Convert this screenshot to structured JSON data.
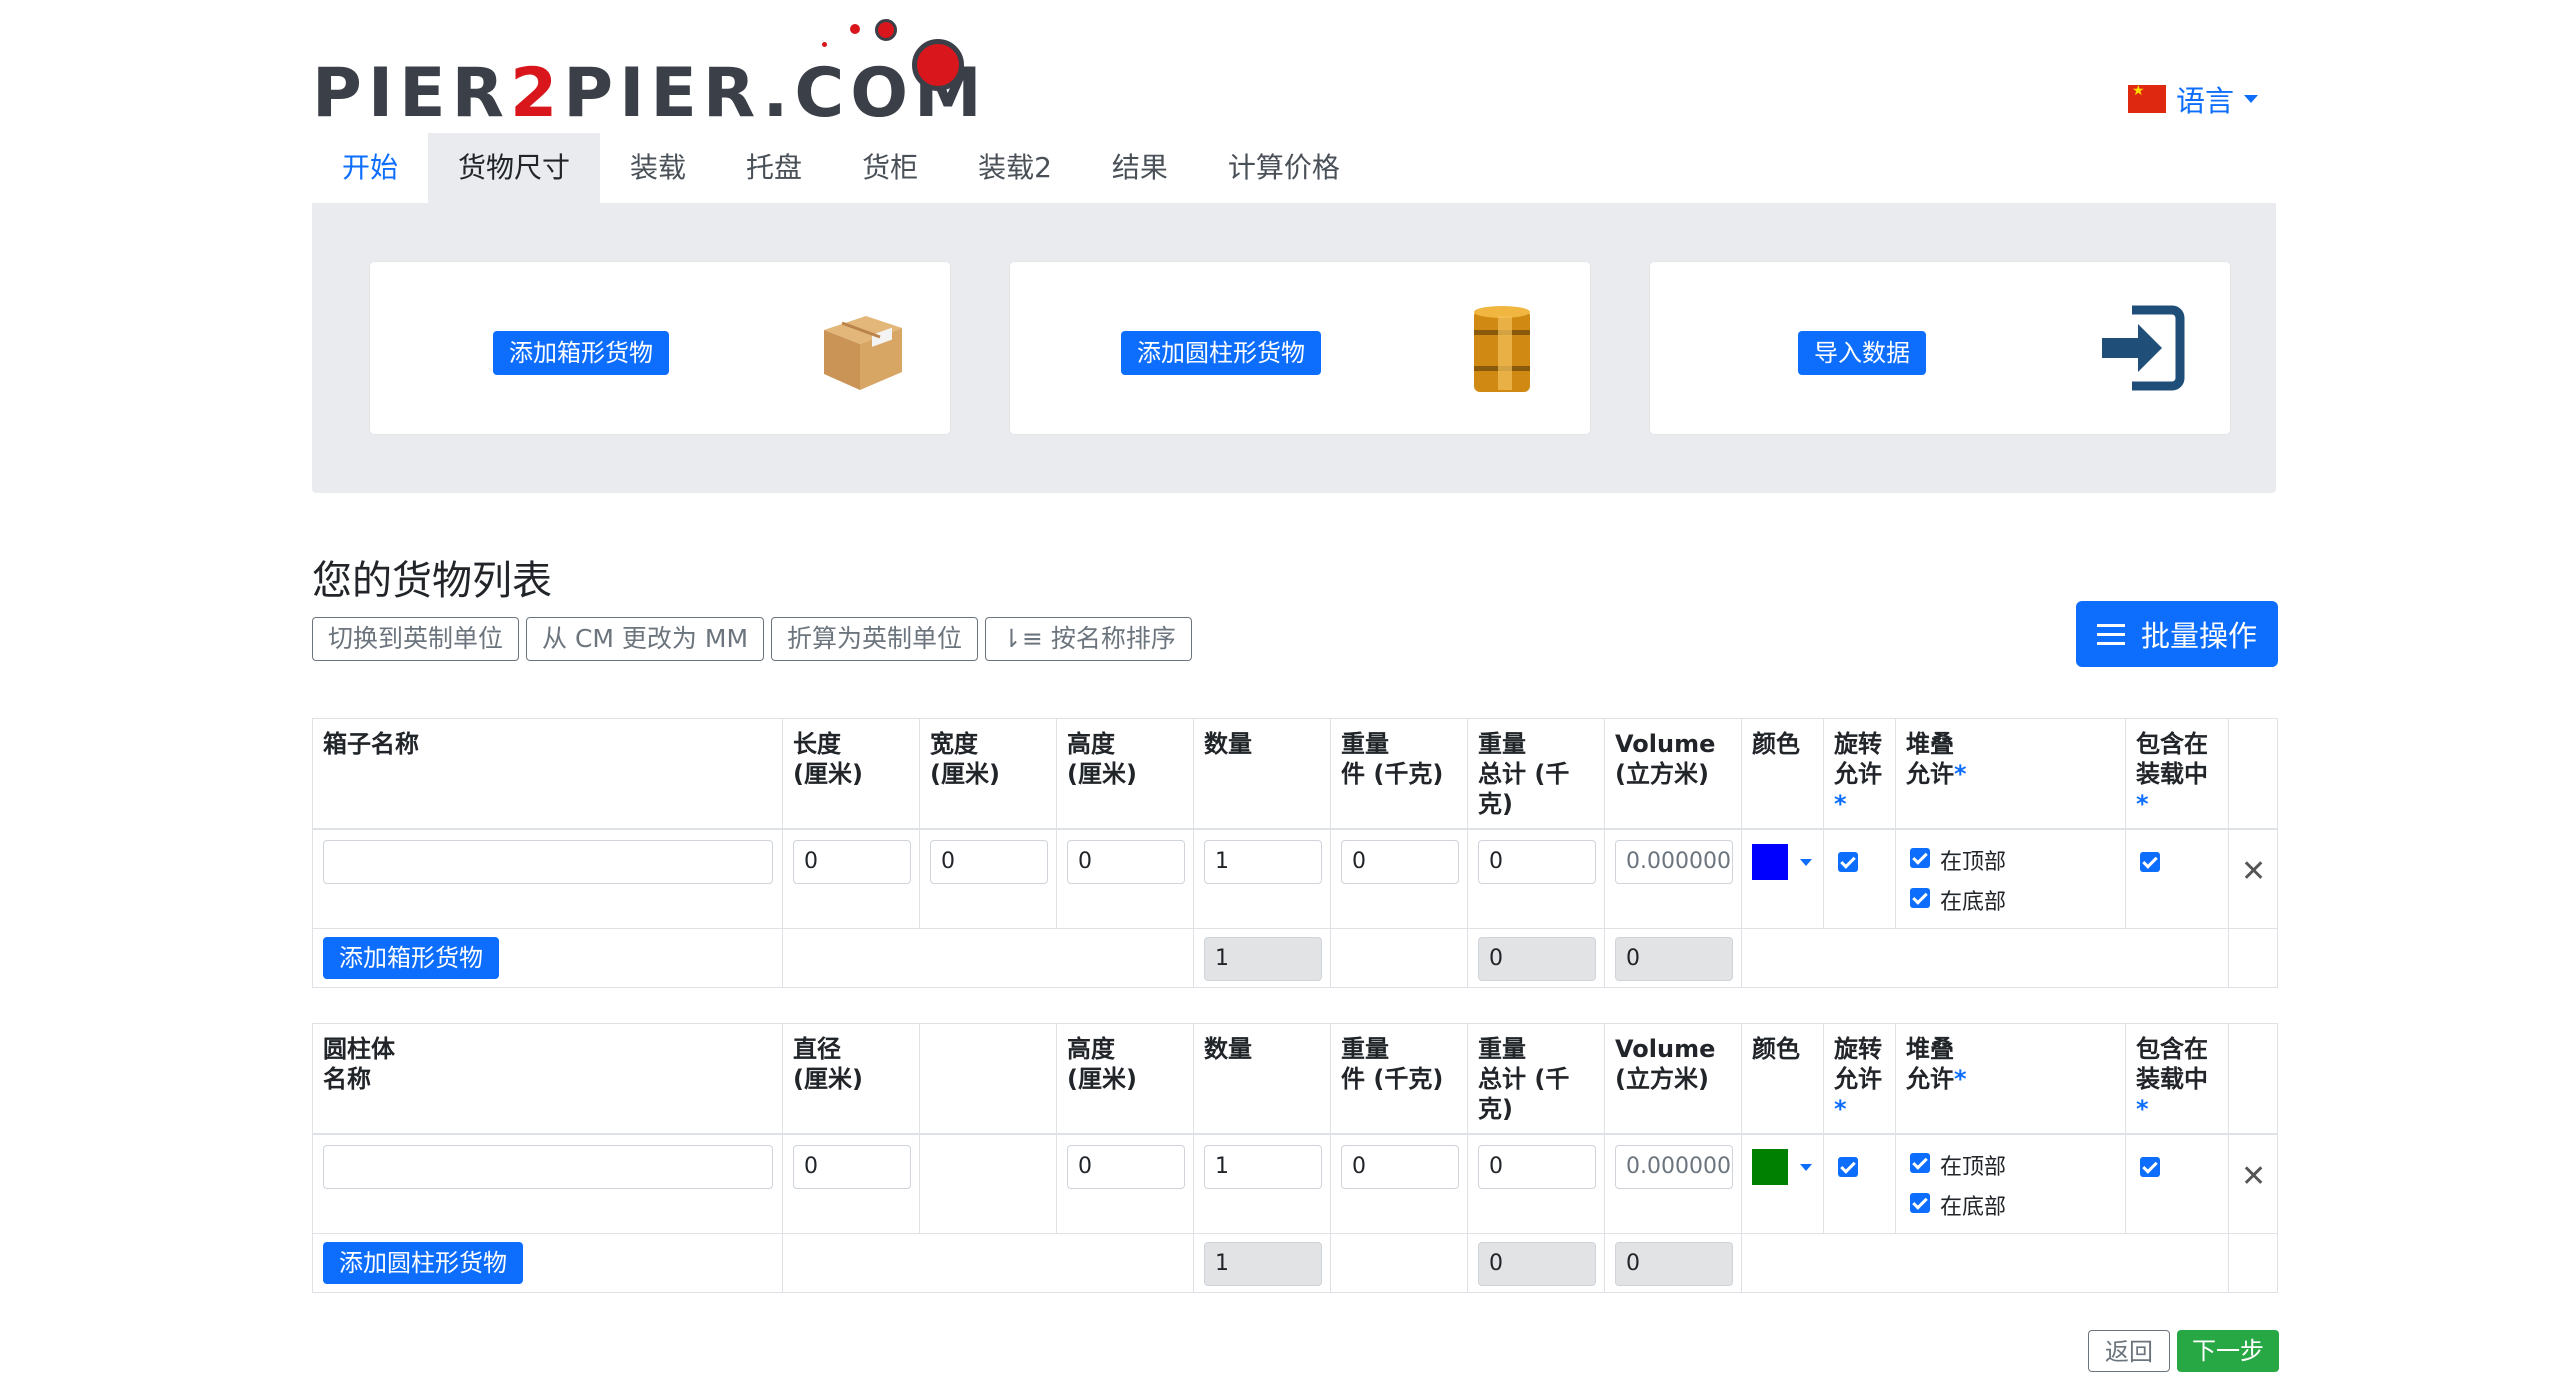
{
  "logo": {
    "part1": "PIER",
    "part2": "2",
    "part3": "PIER.COM"
  },
  "language": {
    "label": "语言"
  },
  "tabs": [
    "开始",
    "货物尺寸",
    "装载",
    "托盘",
    "货柜",
    "装载2",
    "结果",
    "计算价格"
  ],
  "cards": {
    "box": {
      "button": "添加箱形货物",
      "icon": "cardboard-box-icon"
    },
    "cylinder": {
      "button": "添加圆柱形货物",
      "icon": "barrel-icon"
    },
    "import": {
      "button": "导入数据",
      "icon": "import-icon"
    }
  },
  "list": {
    "title": "您的货物列表",
    "tools": [
      "切换到英制单位",
      "从 CM 更改为 MM",
      "折算为英制单位",
      "按名称排序"
    ],
    "bulk": "批量操作"
  },
  "box_table": {
    "headers": {
      "name": "箱子名称",
      "length": [
        "长度",
        "(厘米)"
      ],
      "width": [
        "宽度",
        "(厘米)"
      ],
      "height": [
        "高度",
        "(厘米)"
      ],
      "qty": "数量",
      "weight_piece": [
        "重量",
        "件 (千克)"
      ],
      "weight_total": [
        "重量",
        "总计 (千",
        "克)"
      ],
      "volume": [
        "Volume",
        "(立方米)"
      ],
      "color": "颜色",
      "rotate": [
        "旋转",
        "允许",
        "*"
      ],
      "stack": [
        "堆叠",
        "允许",
        "*"
      ],
      "include": [
        "包含在",
        "装载中",
        "*"
      ]
    },
    "row": {
      "name": "",
      "length": "0",
      "width": "0",
      "height": "0",
      "qty": "1",
      "weight_piece": "0",
      "weight_total": "0",
      "volume": "0.000000",
      "color": "#0000ff",
      "stack_top": "在顶部",
      "stack_bottom": "在底部"
    },
    "footer": {
      "add": "添加箱形货物",
      "qty_total": "1",
      "weight_total": "0",
      "volume_total": "0"
    }
  },
  "cyl_table": {
    "headers": {
      "name": [
        "圆柱体",
        "名称"
      ],
      "diameter": [
        "直径",
        "(厘米)"
      ],
      "height": [
        "高度",
        "(厘米)"
      ],
      "qty": "数量",
      "weight_piece": [
        "重量",
        "件 (千克)"
      ],
      "weight_total": [
        "重量",
        "总计 (千",
        "克)"
      ],
      "volume": [
        "Volume",
        "(立方米)"
      ],
      "color": "颜色",
      "rotate": [
        "旋转",
        "允许",
        "*"
      ],
      "stack": [
        "堆叠",
        "允许",
        "*"
      ],
      "include": [
        "包含在",
        "装载中",
        "*"
      ]
    },
    "row": {
      "name": "",
      "diameter": "0",
      "height": "0",
      "qty": "1",
      "weight_piece": "0",
      "weight_total": "0",
      "volume": "0.000000",
      "color": "#008000",
      "stack_top": "在顶部",
      "stack_bottom": "在底部"
    },
    "footer": {
      "add": "添加圆柱形货物",
      "qty_total": "1",
      "weight_total": "0",
      "volume_total": "0"
    }
  },
  "nav": {
    "back": "返回",
    "next": "下一步"
  }
}
